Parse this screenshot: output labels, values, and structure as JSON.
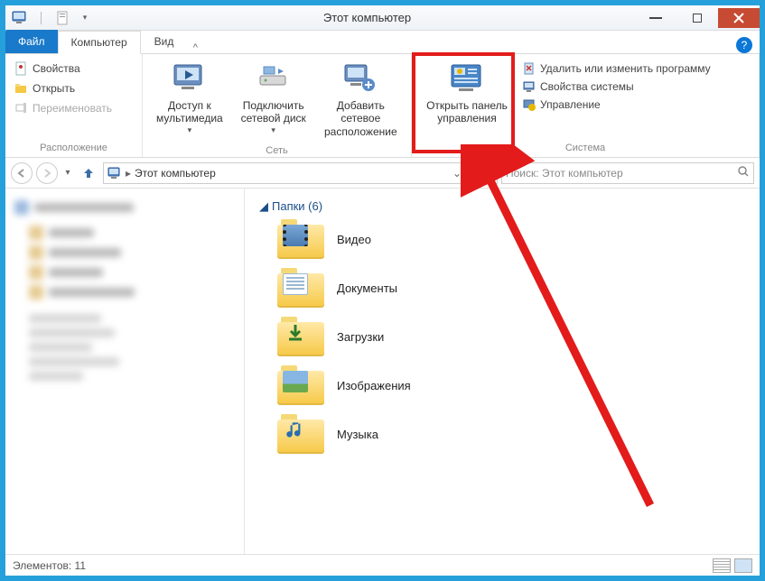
{
  "window": {
    "title": "Этот компьютер"
  },
  "tabs": {
    "file": "Файл",
    "computer": "Компьютер",
    "view": "Вид"
  },
  "ribbon": {
    "group_location": {
      "label": "Расположение",
      "properties": "Свойства",
      "open": "Открыть",
      "rename": "Переименовать"
    },
    "group_network": {
      "label": "Сеть",
      "media_access": "Доступ к мультимедиа",
      "map_drive": "Подключить сетевой диск",
      "add_location": "Добавить сетевое расположение"
    },
    "group_system": {
      "label": "Система",
      "control_panel": "Открыть панель управления",
      "uninstall": "Удалить или изменить программу",
      "sysprops": "Свойства системы",
      "manage": "Управление"
    }
  },
  "nav": {
    "breadcrumb": "Этот компьютер",
    "search_placeholder": "Поиск: Этот компьютер"
  },
  "section": {
    "header": "Папки (6)"
  },
  "folders": [
    {
      "id": "video",
      "label": "Видео"
    },
    {
      "id": "documents",
      "label": "Документы"
    },
    {
      "id": "downloads",
      "label": "Загрузки"
    },
    {
      "id": "pictures",
      "label": "Изображения"
    },
    {
      "id": "music",
      "label": "Музыка"
    }
  ],
  "status": {
    "items": "Элементов: 11"
  }
}
